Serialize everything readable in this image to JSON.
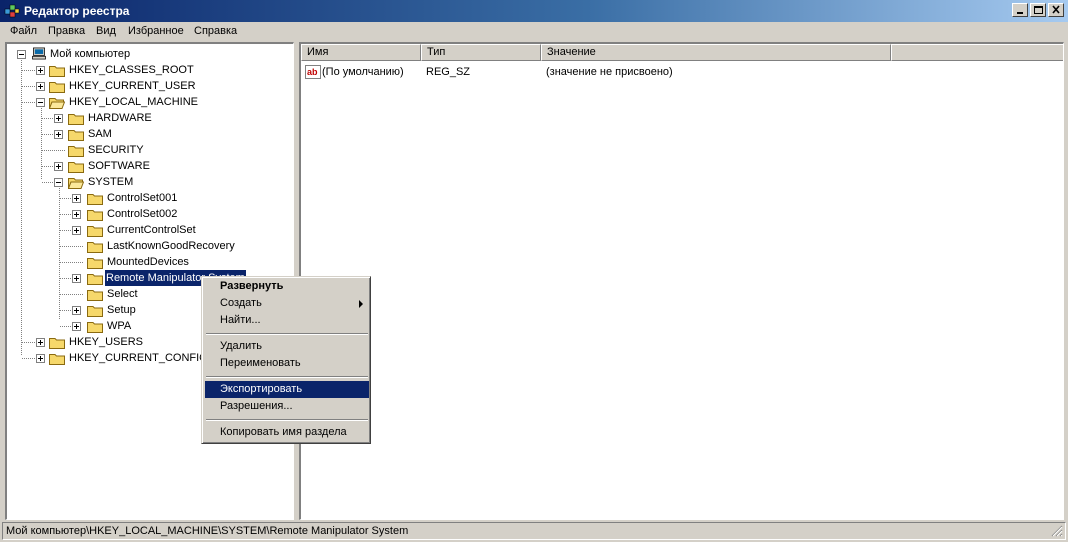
{
  "window": {
    "title": "Редактор реестра",
    "minimize_label": "_",
    "maximize_label": "□",
    "close_label": "✕"
  },
  "menu": [
    "Файл",
    "Правка",
    "Вид",
    "Избранное",
    "Справка"
  ],
  "tree": {
    "root": "Мой компьютер",
    "hkcr": "HKEY_CLASSES_ROOT",
    "hkcu": "HKEY_CURRENT_USER",
    "hklm": "HKEY_LOCAL_MACHINE",
    "hardware": "HARDWARE",
    "sam": "SAM",
    "security": "SECURITY",
    "software": "SOFTWARE",
    "system": "SYSTEM",
    "controlset001": "ControlSet001",
    "controlset002": "ControlSet002",
    "currentcontrolset": "CurrentControlSet",
    "lastknowngood": "LastKnownGoodRecovery",
    "mounteddevices": "MountedDevices",
    "rms": "Remote Manipulator System",
    "select": "Select",
    "setup": "Setup",
    "wpa": "WPA",
    "hku": "HKEY_USERS",
    "hkcc": "HKEY_CURRENT_CONFIG"
  },
  "list": {
    "columns": [
      "Имя",
      "Тип",
      "Значение"
    ],
    "rows": [
      {
        "name": "(По умолчанию)",
        "type": "REG_SZ",
        "value": "(значение не присвоено)",
        "icon": "ab"
      }
    ]
  },
  "context_menu": {
    "expand": "Развернуть",
    "create": "Создать",
    "find": "Найти...",
    "delete": "Удалить",
    "rename": "Переименовать",
    "export": "Экспортировать",
    "permissions": "Разрешения...",
    "copy_key_name": "Копировать имя раздела"
  },
  "statusbar": "Мой компьютер\\HKEY_LOCAL_MACHINE\\SYSTEM\\Remote Manipulator System",
  "colors": {
    "selection": "#0a246a",
    "face": "#d4d0c8",
    "folder": "#f6d86b"
  }
}
